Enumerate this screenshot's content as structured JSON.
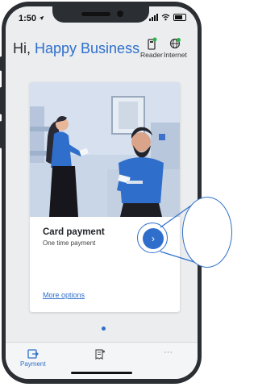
{
  "status_bar": {
    "time": "1:50"
  },
  "header": {
    "greeting_prefix": "Hi, ",
    "business_name": "Happy Business",
    "reader_label": "Reader",
    "internet_label": "Internet"
  },
  "card": {
    "title": "Card payment",
    "subtitle": "One time payment",
    "go_button": "›",
    "more_options": "More options"
  },
  "tabs": {
    "payment_label": "Payment",
    "more_label": "···"
  },
  "colors": {
    "accent": "#2f6fcb",
    "status_ok": "#2bb34a"
  }
}
